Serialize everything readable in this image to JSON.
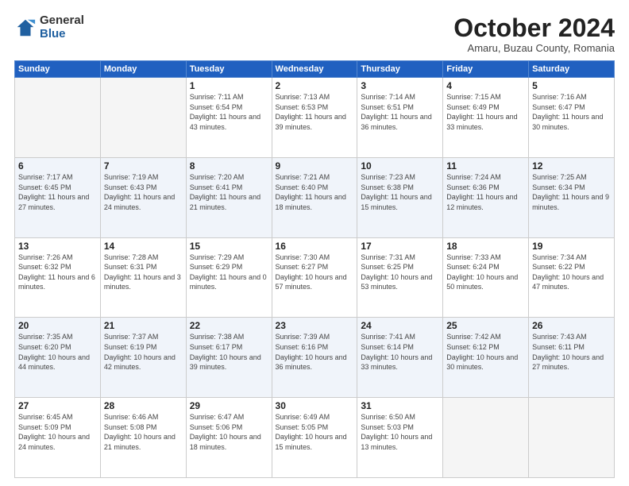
{
  "logo": {
    "general": "General",
    "blue": "Blue"
  },
  "header": {
    "month": "October 2024",
    "location": "Amaru, Buzau County, Romania"
  },
  "days_of_week": [
    "Sunday",
    "Monday",
    "Tuesday",
    "Wednesday",
    "Thursday",
    "Friday",
    "Saturday"
  ],
  "weeks": [
    [
      {
        "day": "",
        "info": ""
      },
      {
        "day": "",
        "info": ""
      },
      {
        "day": "1",
        "sunrise": "7:11 AM",
        "sunset": "6:54 PM",
        "daylight": "11 hours and 43 minutes."
      },
      {
        "day": "2",
        "sunrise": "7:13 AM",
        "sunset": "6:53 PM",
        "daylight": "11 hours and 39 minutes."
      },
      {
        "day": "3",
        "sunrise": "7:14 AM",
        "sunset": "6:51 PM",
        "daylight": "11 hours and 36 minutes."
      },
      {
        "day": "4",
        "sunrise": "7:15 AM",
        "sunset": "6:49 PM",
        "daylight": "11 hours and 33 minutes."
      },
      {
        "day": "5",
        "sunrise": "7:16 AM",
        "sunset": "6:47 PM",
        "daylight": "11 hours and 30 minutes."
      }
    ],
    [
      {
        "day": "6",
        "sunrise": "7:17 AM",
        "sunset": "6:45 PM",
        "daylight": "11 hours and 27 minutes."
      },
      {
        "day": "7",
        "sunrise": "7:19 AM",
        "sunset": "6:43 PM",
        "daylight": "11 hours and 24 minutes."
      },
      {
        "day": "8",
        "sunrise": "7:20 AM",
        "sunset": "6:41 PM",
        "daylight": "11 hours and 21 minutes."
      },
      {
        "day": "9",
        "sunrise": "7:21 AM",
        "sunset": "6:40 PM",
        "daylight": "11 hours and 18 minutes."
      },
      {
        "day": "10",
        "sunrise": "7:23 AM",
        "sunset": "6:38 PM",
        "daylight": "11 hours and 15 minutes."
      },
      {
        "day": "11",
        "sunrise": "7:24 AM",
        "sunset": "6:36 PM",
        "daylight": "11 hours and 12 minutes."
      },
      {
        "day": "12",
        "sunrise": "7:25 AM",
        "sunset": "6:34 PM",
        "daylight": "11 hours and 9 minutes."
      }
    ],
    [
      {
        "day": "13",
        "sunrise": "7:26 AM",
        "sunset": "6:32 PM",
        "daylight": "11 hours and 6 minutes."
      },
      {
        "day": "14",
        "sunrise": "7:28 AM",
        "sunset": "6:31 PM",
        "daylight": "11 hours and 3 minutes."
      },
      {
        "day": "15",
        "sunrise": "7:29 AM",
        "sunset": "6:29 PM",
        "daylight": "11 hours and 0 minutes."
      },
      {
        "day": "16",
        "sunrise": "7:30 AM",
        "sunset": "6:27 PM",
        "daylight": "10 hours and 57 minutes."
      },
      {
        "day": "17",
        "sunrise": "7:31 AM",
        "sunset": "6:25 PM",
        "daylight": "10 hours and 53 minutes."
      },
      {
        "day": "18",
        "sunrise": "7:33 AM",
        "sunset": "6:24 PM",
        "daylight": "10 hours and 50 minutes."
      },
      {
        "day": "19",
        "sunrise": "7:34 AM",
        "sunset": "6:22 PM",
        "daylight": "10 hours and 47 minutes."
      }
    ],
    [
      {
        "day": "20",
        "sunrise": "7:35 AM",
        "sunset": "6:20 PM",
        "daylight": "10 hours and 44 minutes."
      },
      {
        "day": "21",
        "sunrise": "7:37 AM",
        "sunset": "6:19 PM",
        "daylight": "10 hours and 42 minutes."
      },
      {
        "day": "22",
        "sunrise": "7:38 AM",
        "sunset": "6:17 PM",
        "daylight": "10 hours and 39 minutes."
      },
      {
        "day": "23",
        "sunrise": "7:39 AM",
        "sunset": "6:16 PM",
        "daylight": "10 hours and 36 minutes."
      },
      {
        "day": "24",
        "sunrise": "7:41 AM",
        "sunset": "6:14 PM",
        "daylight": "10 hours and 33 minutes."
      },
      {
        "day": "25",
        "sunrise": "7:42 AM",
        "sunset": "6:12 PM",
        "daylight": "10 hours and 30 minutes."
      },
      {
        "day": "26",
        "sunrise": "7:43 AM",
        "sunset": "6:11 PM",
        "daylight": "10 hours and 27 minutes."
      }
    ],
    [
      {
        "day": "27",
        "sunrise": "6:45 AM",
        "sunset": "5:09 PM",
        "daylight": "10 hours and 24 minutes."
      },
      {
        "day": "28",
        "sunrise": "6:46 AM",
        "sunset": "5:08 PM",
        "daylight": "10 hours and 21 minutes."
      },
      {
        "day": "29",
        "sunrise": "6:47 AM",
        "sunset": "5:06 PM",
        "daylight": "10 hours and 18 minutes."
      },
      {
        "day": "30",
        "sunrise": "6:49 AM",
        "sunset": "5:05 PM",
        "daylight": "10 hours and 15 minutes."
      },
      {
        "day": "31",
        "sunrise": "6:50 AM",
        "sunset": "5:03 PM",
        "daylight": "10 hours and 13 minutes."
      },
      {
        "day": "",
        "info": ""
      },
      {
        "day": "",
        "info": ""
      }
    ]
  ]
}
